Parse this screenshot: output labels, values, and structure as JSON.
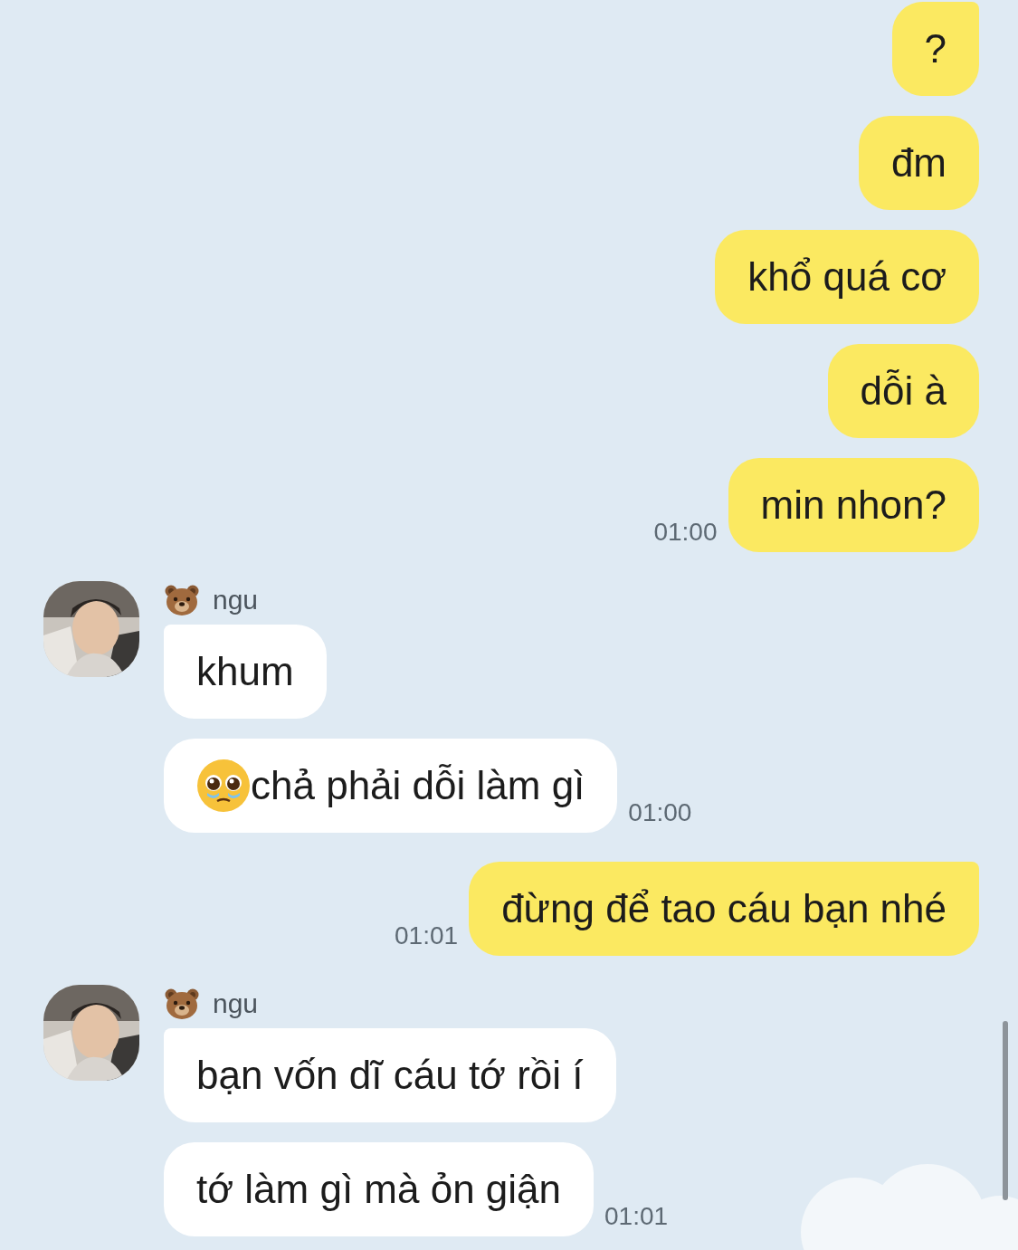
{
  "groups": [
    {
      "kind": "sent",
      "messages": [
        {
          "text": "?"
        },
        {
          "text": "đm"
        },
        {
          "text": "khổ quá cơ"
        },
        {
          "text": "dỗi à"
        },
        {
          "text": "min nhon?",
          "time": "01:00"
        }
      ]
    },
    {
      "kind": "received",
      "sender": "ngu",
      "messages": [
        {
          "text": "khum"
        },
        {
          "text": "chả phải dỗi làm gì",
          "icon": true,
          "time": "01:00"
        }
      ]
    },
    {
      "kind": "sent",
      "messages": [
        {
          "text": "đừng để tao cáu bạn nhé",
          "time": "01:01"
        }
      ]
    },
    {
      "kind": "received",
      "sender": "ngu",
      "messages": [
        {
          "text": "bạn vốn dĩ cáu tớ rồi í"
        },
        {
          "text": "tớ làm gì mà ỏn giận",
          "time": "01:01"
        }
      ]
    }
  ]
}
